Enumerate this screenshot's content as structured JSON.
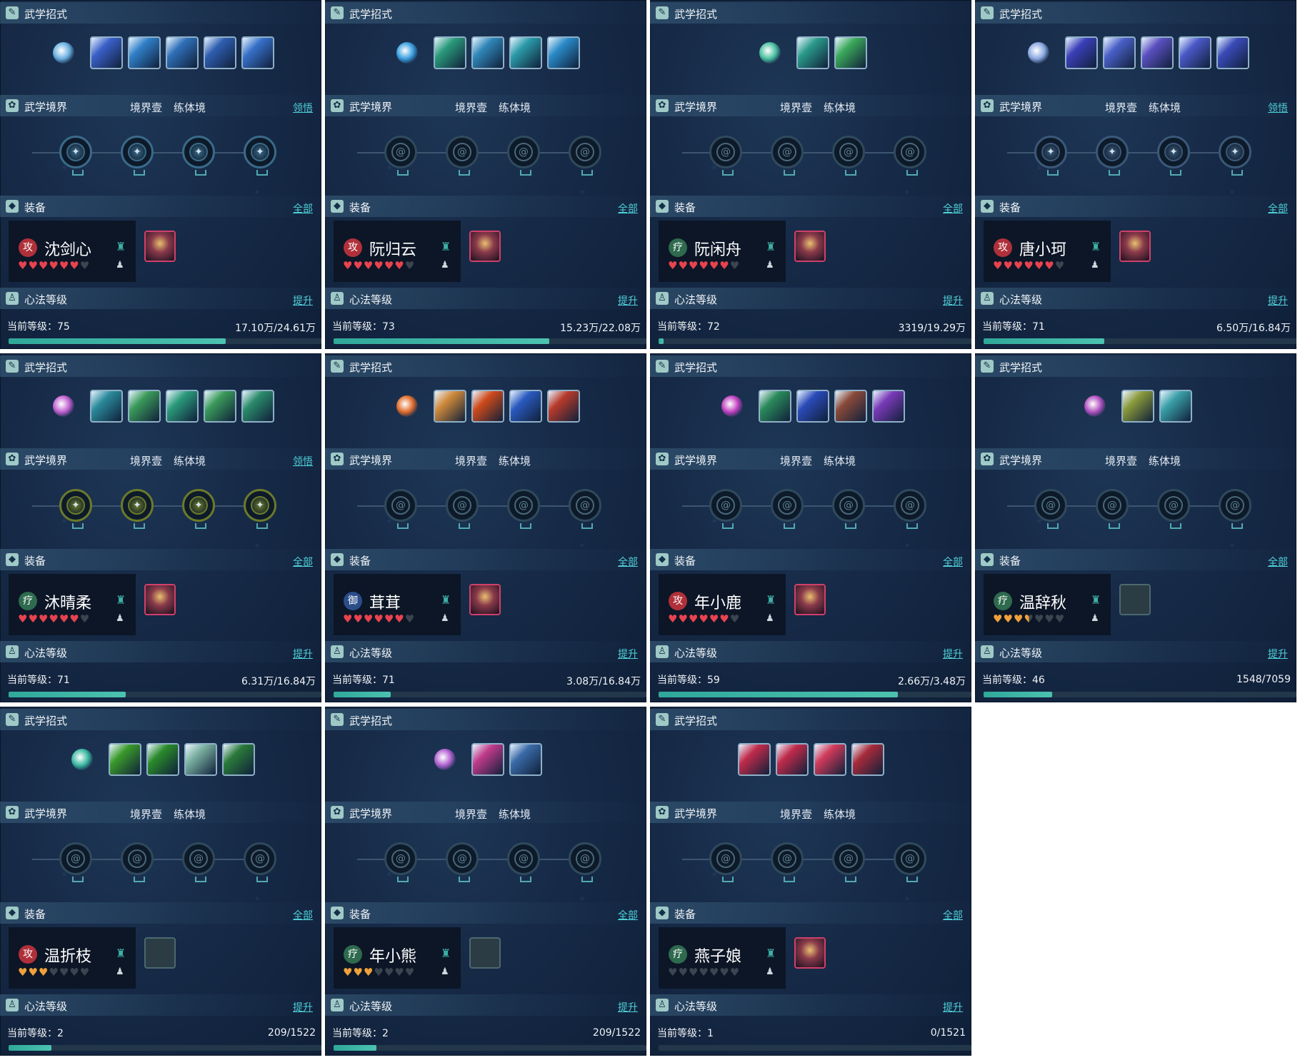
{
  "labels": {
    "skills_header": "武学招式",
    "realm_header": "武学境界",
    "realm_stage": "境界壹",
    "realm_name": "练体境",
    "realm_link": "领悟",
    "equip_header": "装备",
    "equip_link": "全部",
    "mind_header": "心法等级",
    "mind_link": "提升"
  },
  "colors": {
    "panel_bg": "#162a47",
    "accent_link": "#4fd0d8",
    "progress": "#3cb5a5",
    "heart_red": "#e8434f",
    "heart_gold": "#f0a13a",
    "heart_empty": "#3b4550",
    "role_attack": "#b0303a",
    "role_heal": "#2e6a4e",
    "role_defend": "#2a4d8a"
  },
  "characters": [
    {
      "name": "沈剑心",
      "role_label": "攻",
      "role_type": "attack",
      "hearts_filled": 6,
      "hearts_total": 7,
      "heart_color": "red",
      "level_text": "当前等级：75",
      "xp_text": "17.10万/24.61万",
      "progress": 0.695,
      "show_realm_link": true,
      "realm_unlocked": true,
      "equip_icon": "robe-red-equipment-icon",
      "equip_empty": false,
      "main_skill_color": "#6ab0e0",
      "skill_colors": [
        "#3a5fc8",
        "#2f7fc8",
        "#2f6fb8",
        "#2e5db0",
        "#3670c8"
      ],
      "node_colors": [
        "#3a6a8a",
        "#3a6a8a",
        "#3a6a8a",
        "#3a6a8a"
      ]
    },
    {
      "name": "阮归云",
      "role_label": "攻",
      "role_type": "attack",
      "hearts_filled": 6,
      "hearts_total": 7,
      "heart_color": "red",
      "level_text": "当前等级：73",
      "xp_text": "15.23万/22.08万",
      "progress": 0.69,
      "show_realm_link": false,
      "realm_unlocked": false,
      "equip_icon": "armor-gold-equipment-icon",
      "equip_empty": false,
      "main_skill_color": "#3aa0e0",
      "skill_colors": [
        "#2a9a7a",
        "#2f86b8",
        "#2a9aa8",
        "#2a8ac8"
      ],
      "node_colors": []
    },
    {
      "name": "阮闲舟",
      "role_label": "疗",
      "role_type": "heal",
      "hearts_filled": 6,
      "hearts_total": 7,
      "heart_color": "red",
      "level_text": "当前等级：72",
      "xp_text": "3319/19.29万",
      "progress": 0.017,
      "show_realm_link": false,
      "realm_unlocked": false,
      "equip_icon": "armor-gold-equipment-icon",
      "equip_empty": false,
      "main_skill_color": "#4ac0a0",
      "skill_colors": [
        "#2a9a8a",
        "#3aa85a"
      ],
      "node_colors": []
    },
    {
      "name": "唐小珂",
      "role_label": "攻",
      "role_type": "attack",
      "hearts_filled": 6,
      "hearts_total": 7,
      "heart_color": "red",
      "level_text": "当前等级：71",
      "xp_text": "6.50万/16.84万",
      "progress": 0.386,
      "show_realm_link": true,
      "realm_unlocked": true,
      "equip_icon": "robe-red-equipment-icon",
      "equip_empty": false,
      "main_skill_color": "#8aa8e0",
      "skill_colors": [
        "#3a3fb8",
        "#4a60c8",
        "#5a4fc0",
        "#4a58c8",
        "#3a4ab8"
      ],
      "node_colors": [
        "#3a5878",
        "#3a5878",
        "#3a5878",
        "#3a5878"
      ]
    },
    {
      "name": "沐晴柔",
      "role_label": "疗",
      "role_type": "heal",
      "hearts_filled": 6,
      "hearts_total": 7,
      "heart_color": "red",
      "level_text": "当前等级：71",
      "xp_text": "6.31万/16.84万",
      "progress": 0.375,
      "show_realm_link": true,
      "realm_unlocked": true,
      "equip_icon": "armor-gold-equipment-icon",
      "equip_empty": false,
      "main_skill_color": "#c060d0",
      "skill_colors": [
        "#2a8a9a",
        "#3a9a5a",
        "#2a9a7a",
        "#3a9a5a",
        "#2a8a6a"
      ],
      "node_colors": [
        "#6a7a2a",
        "#6a7a2a",
        "#6a7a2a",
        "#6a7a2a"
      ]
    },
    {
      "name": "茸茸",
      "role_label": "御",
      "role_type": "defend",
      "hearts_filled": 6,
      "hearts_total": 7,
      "heart_color": "red",
      "level_text": "当前等级：71",
      "xp_text": "3.08万/16.84万",
      "progress": 0.183,
      "show_realm_link": false,
      "realm_unlocked": false,
      "equip_icon": "robe-gold-equipment-icon",
      "equip_empty": false,
      "main_skill_color": "#e06a2a",
      "skill_colors": [
        "#d08a3a",
        "#d04a1a",
        "#2a5ac0",
        "#b83a2a"
      ],
      "node_colors": []
    },
    {
      "name": "年小鹿",
      "role_label": "攻",
      "role_type": "attack",
      "hearts_filled": 6,
      "hearts_total": 7,
      "heart_color": "red",
      "level_text": "当前等级：59",
      "xp_text": "2.66万/3.48万",
      "progress": 0.764,
      "show_realm_link": false,
      "realm_unlocked": false,
      "equip_icon": "robe-gold-equipment-icon",
      "equip_empty": false,
      "main_skill_color": "#c040c0",
      "skill_colors": [
        "#2a8a5a",
        "#2a4ab8",
        "#8a4a3a",
        "#7a3ab8"
      ],
      "node_colors": []
    },
    {
      "name": "温辞秋",
      "role_label": "疗",
      "role_type": "heal",
      "hearts_filled": 3.5,
      "hearts_total": 7,
      "heart_color": "gold",
      "level_text": "当前等级：46",
      "xp_text": "1548/7059",
      "progress": 0.219,
      "show_realm_link": false,
      "realm_unlocked": false,
      "equip_icon": "empty-equipment-slot-icon",
      "equip_empty": true,
      "main_skill_color": "#b050c0",
      "skill_colors": [
        "#8a9a3a",
        "#3aa0a8"
      ],
      "node_colors": []
    },
    {
      "name": "温折枝",
      "role_label": "攻",
      "role_type": "attack",
      "hearts_filled": 3,
      "hearts_total": 7,
      "heart_color": "gold",
      "level_text": "当前等级：2",
      "xp_text": "209/1522",
      "progress": 0.137,
      "show_realm_link": false,
      "realm_unlocked": false,
      "equip_icon": "empty-equipment-slot-icon",
      "equip_empty": true,
      "main_skill_color": "#3ab8a0",
      "skill_colors": [
        "#3a9a2a",
        "#2a8a2a",
        "#7ab0a0",
        "#2a7a3a"
      ],
      "node_colors": []
    },
    {
      "name": "年小熊",
      "role_label": "疗",
      "role_type": "heal",
      "hearts_filled": 3,
      "hearts_total": 7,
      "heart_color": "gold",
      "level_text": "当前等级：2",
      "xp_text": "209/1522",
      "progress": 0.137,
      "show_realm_link": false,
      "realm_unlocked": false,
      "equip_icon": "empty-equipment-slot-icon",
      "equip_empty": true,
      "main_skill_color": "#b060d0",
      "skill_colors": [
        "#c03a8a",
        "#3a6aa8"
      ],
      "node_colors": []
    },
    {
      "name": "燕子娘",
      "role_label": "疗",
      "role_type": "heal",
      "hearts_filled": 0,
      "hearts_total": 7,
      "heart_color": "red",
      "level_text": "当前等级：1",
      "xp_text": "0/1521",
      "progress": 0.0,
      "show_realm_link": false,
      "realm_unlocked": false,
      "equip_icon": "robe-teal-equipment-icon",
      "equip_empty": false,
      "main_skill_color": "",
      "skill_colors": [
        "#c02a4a",
        "#c02a4a",
        "#d03a5a",
        "#a82a3a"
      ],
      "node_colors": []
    }
  ]
}
